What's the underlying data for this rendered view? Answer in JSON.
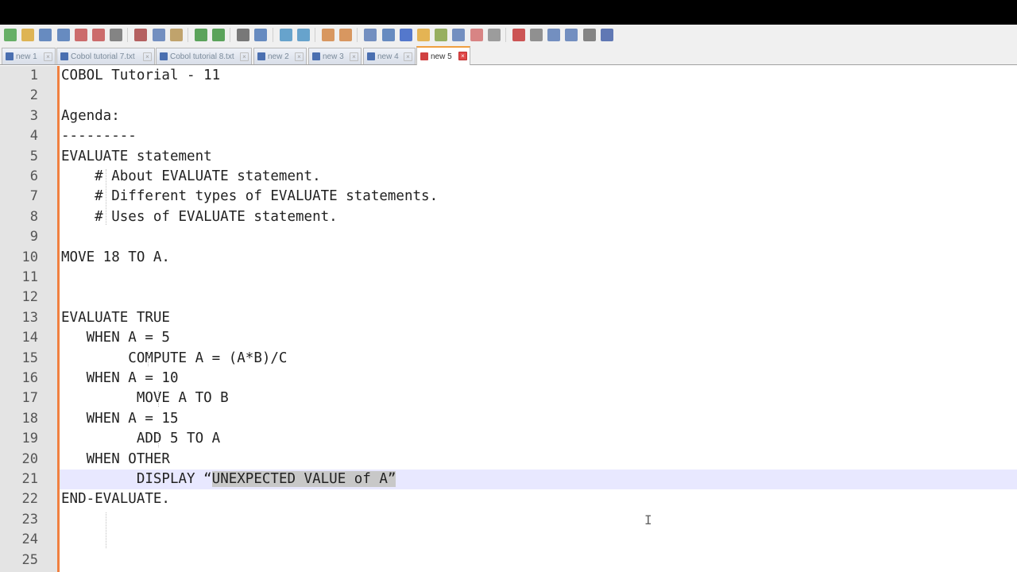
{
  "toolbar": {
    "icons": [
      "new-file-icon",
      "open-file-icon",
      "save-icon",
      "save-all-icon",
      "close-icon",
      "close-all-icon",
      "print-icon",
      "cut-icon",
      "copy-icon",
      "paste-icon",
      "undo-icon",
      "redo-icon",
      "find-icon",
      "replace-icon",
      "zoom-in-icon",
      "zoom-out-icon",
      "sync-vertical-icon",
      "sync-horizontal-icon",
      "word-wrap-icon",
      "show-all-chars-icon",
      "indent-guide-icon",
      "user-lang-icon",
      "doc-map-icon",
      "function-list-icon",
      "folder-workspace-icon",
      "monitoring-icon",
      "record-macro-icon",
      "stop-macro-icon",
      "play-macro-icon",
      "run-macro-multiple-icon",
      "save-macro-icon",
      "spell-check-icon"
    ]
  },
  "tabs": [
    {
      "label": "new 1",
      "active": false
    },
    {
      "label": "Cobol tutorial 7.txt",
      "active": false
    },
    {
      "label": "Cobol tutorial 8.txt",
      "active": false
    },
    {
      "label": "new 2",
      "active": false
    },
    {
      "label": "new 3",
      "active": false
    },
    {
      "label": "new 4",
      "active": false
    },
    {
      "label": "new 5",
      "active": true
    }
  ],
  "editor": {
    "current_line": 21,
    "lines": [
      {
        "n": "1",
        "text": "COBOL Tutorial - 11"
      },
      {
        "n": "2",
        "text": ""
      },
      {
        "n": "3",
        "text": "Agenda:"
      },
      {
        "n": "4",
        "text": "---------"
      },
      {
        "n": "5",
        "text": "EVALUATE statement"
      },
      {
        "n": "6",
        "text": "    # About EVALUATE statement."
      },
      {
        "n": "7",
        "text": "    # Different types of EVALUATE statements."
      },
      {
        "n": "8",
        "text": "    # Uses of EVALUATE statement."
      },
      {
        "n": "9",
        "text": ""
      },
      {
        "n": "10",
        "text": "MOVE 18 TO A."
      },
      {
        "n": "11",
        "text": ""
      },
      {
        "n": "12",
        "text": ""
      },
      {
        "n": "13",
        "text": "EVALUATE TRUE"
      },
      {
        "n": "14",
        "text": "   WHEN A = 5"
      },
      {
        "n": "15",
        "text": "        COMPUTE A = (A*B)/C"
      },
      {
        "n": "16",
        "text": "   WHEN A = 10"
      },
      {
        "n": "17",
        "text": "         MOVE A TO B"
      },
      {
        "n": "18",
        "text": "   WHEN A = 15"
      },
      {
        "n": "19",
        "text": "         ADD 5 TO A"
      },
      {
        "n": "20",
        "text": "   WHEN OTHER"
      },
      {
        "n": "21",
        "text_before": "         DISPLAY “",
        "text_selected": "UNEXPECTED VALUE of A”"
      },
      {
        "n": "22",
        "text": "END-EVALUATE."
      },
      {
        "n": "23",
        "text": ""
      },
      {
        "n": "24",
        "text": ""
      },
      {
        "n": "25",
        "text": ""
      }
    ]
  },
  "colors": {
    "gutter": "#e4e4e4",
    "margin_accent": "#f08040",
    "current_line_highlight": "#e8e8ff",
    "selection": "#c8c8c8",
    "active_tab_close": "#e04848"
  }
}
